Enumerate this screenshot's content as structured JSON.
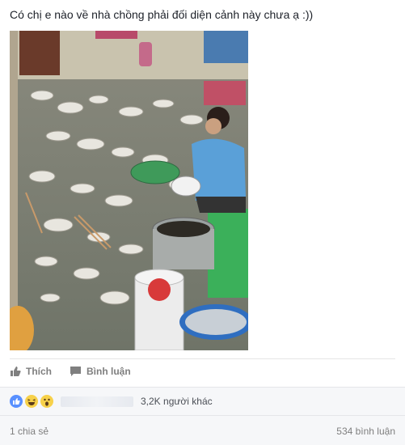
{
  "post": {
    "text": "Có chị e nào về nhà chồng phải đối diện cảnh này chưa ạ :))"
  },
  "actions": {
    "like_label": "Thích",
    "comment_label": "Bình luận"
  },
  "reactions": {
    "icons": [
      "like-icon",
      "haha-icon",
      "wow-icon"
    ],
    "others_text": "3,2K người khác"
  },
  "footer": {
    "shares": "1 chia sẻ",
    "comments": "534 bình luận"
  },
  "colors": {
    "like_blue": "#5890ff",
    "meta_gray": "#7f7f7f"
  }
}
